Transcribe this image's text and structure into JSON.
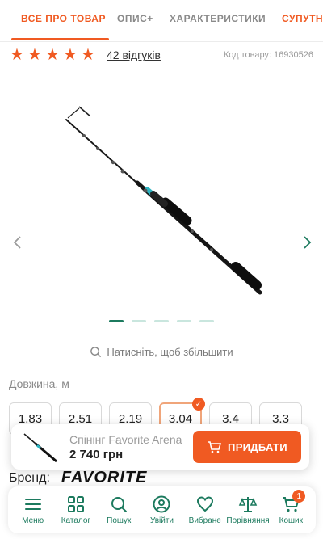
{
  "tabs": [
    {
      "label": "Все про товар",
      "active": true
    },
    {
      "label": "Опис+",
      "active": false
    },
    {
      "label": "Характеристики",
      "active": false
    },
    {
      "label": "Супутні",
      "active": false
    }
  ],
  "rating": {
    "stars": 5,
    "reviews_label": "42 відгуків"
  },
  "product_code": "Код товару: 16930526",
  "gallery": {
    "total_slides": 5,
    "active_slide": 1
  },
  "zoom_hint": "Натисніть, щоб збільшити",
  "length": {
    "label": "Довжина, м",
    "options": [
      "1.83",
      "2.51",
      "2.19",
      "3.04",
      "3.4",
      "3.3"
    ],
    "selected": "3.04"
  },
  "buybar": {
    "name": "Спінінг Favorite Arena",
    "price": "2 740 грн",
    "buy_label": "ПРИДБАТИ"
  },
  "brand": {
    "label": "Бренд:",
    "name": "FAVORITE"
  },
  "nav": [
    {
      "label": "Меню",
      "icon": "menu-icon"
    },
    {
      "label": "Каталог",
      "icon": "catalog-icon"
    },
    {
      "label": "Пошук",
      "icon": "search-icon"
    },
    {
      "label": "Увійти",
      "icon": "user-icon"
    },
    {
      "label": "Вибране",
      "icon": "heart-icon"
    },
    {
      "label": "Порівняння",
      "icon": "scales-icon"
    },
    {
      "label": "Кошик",
      "icon": "cart-icon",
      "badge": "1"
    }
  ],
  "colors": {
    "accent": "#f05a22",
    "green": "#1c7a5e"
  }
}
